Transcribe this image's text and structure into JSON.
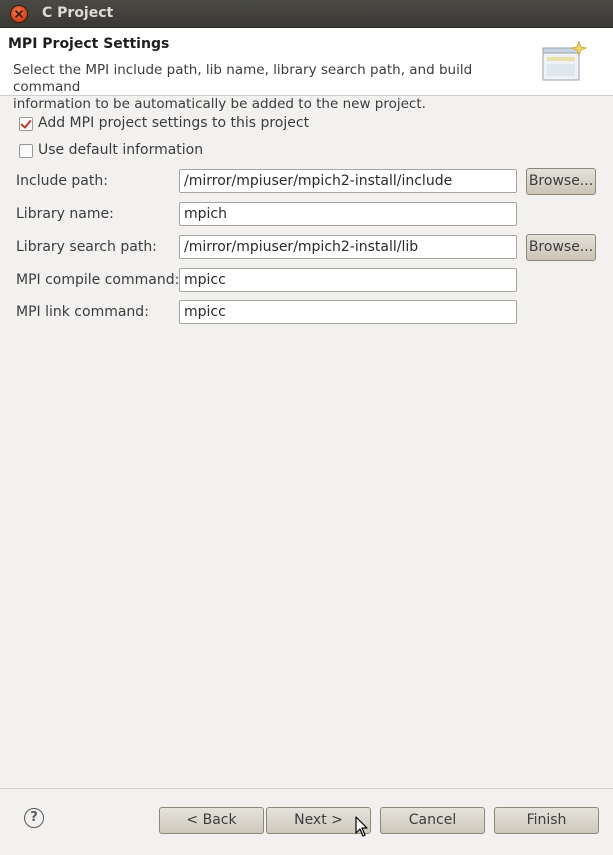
{
  "window": {
    "title": "C Project"
  },
  "header": {
    "title": "MPI Project Settings",
    "description_line1": "Select the MPI include path, lib name, library search path, and build command",
    "description_line2": "information to be automatically be added to the new project."
  },
  "options": {
    "add_mpi": {
      "label": "Add MPI project settings to this project",
      "checked": true
    },
    "use_default": {
      "label": "Use default information",
      "checked": false
    }
  },
  "fields": {
    "include_path": {
      "label": "Include path:",
      "value": "/mirror/mpiuser/mpich2-install/include"
    },
    "library_name": {
      "label": "Library name:",
      "value": "mpich"
    },
    "library_search_path": {
      "label": "Library search path:",
      "value": "/mirror/mpiuser/mpich2-install/lib"
    },
    "compile_command": {
      "label": "MPI compile command:",
      "value": "mpicc"
    },
    "link_command": {
      "label": "MPI link command:",
      "value": "mpicc"
    }
  },
  "buttons": {
    "browse": "Browse...",
    "back": "< Back",
    "next": "Next >",
    "cancel": "Cancel",
    "finish": "Finish",
    "help": "?"
  },
  "colors": {
    "titlebar": "#3c3b37",
    "checkmark": "#c0392b",
    "close": "#df4b16"
  }
}
